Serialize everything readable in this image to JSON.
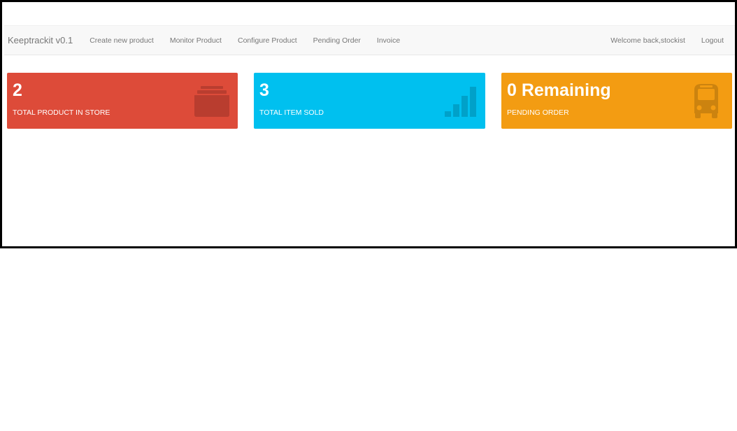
{
  "navbar": {
    "brand": "Keeptrackit v0.1",
    "links": [
      "Create new product",
      "Monitor Product",
      "Configure Product",
      "Pending Order",
      "Invoice"
    ],
    "welcome": "Welcome back,stockist",
    "logout": "Logout"
  },
  "stats": [
    {
      "value": "2",
      "label": "TOTAL PRODUCT IN STORE",
      "icon": "archive-icon",
      "color": "#dd4b39"
    },
    {
      "value": "3",
      "label": "TOTAL ITEM SOLD",
      "icon": "signal-bars-icon",
      "color": "#00c0ef"
    },
    {
      "value": "0 Remaining",
      "label": "PENDING ORDER",
      "icon": "bus-icon",
      "color": "#f39c12"
    }
  ]
}
